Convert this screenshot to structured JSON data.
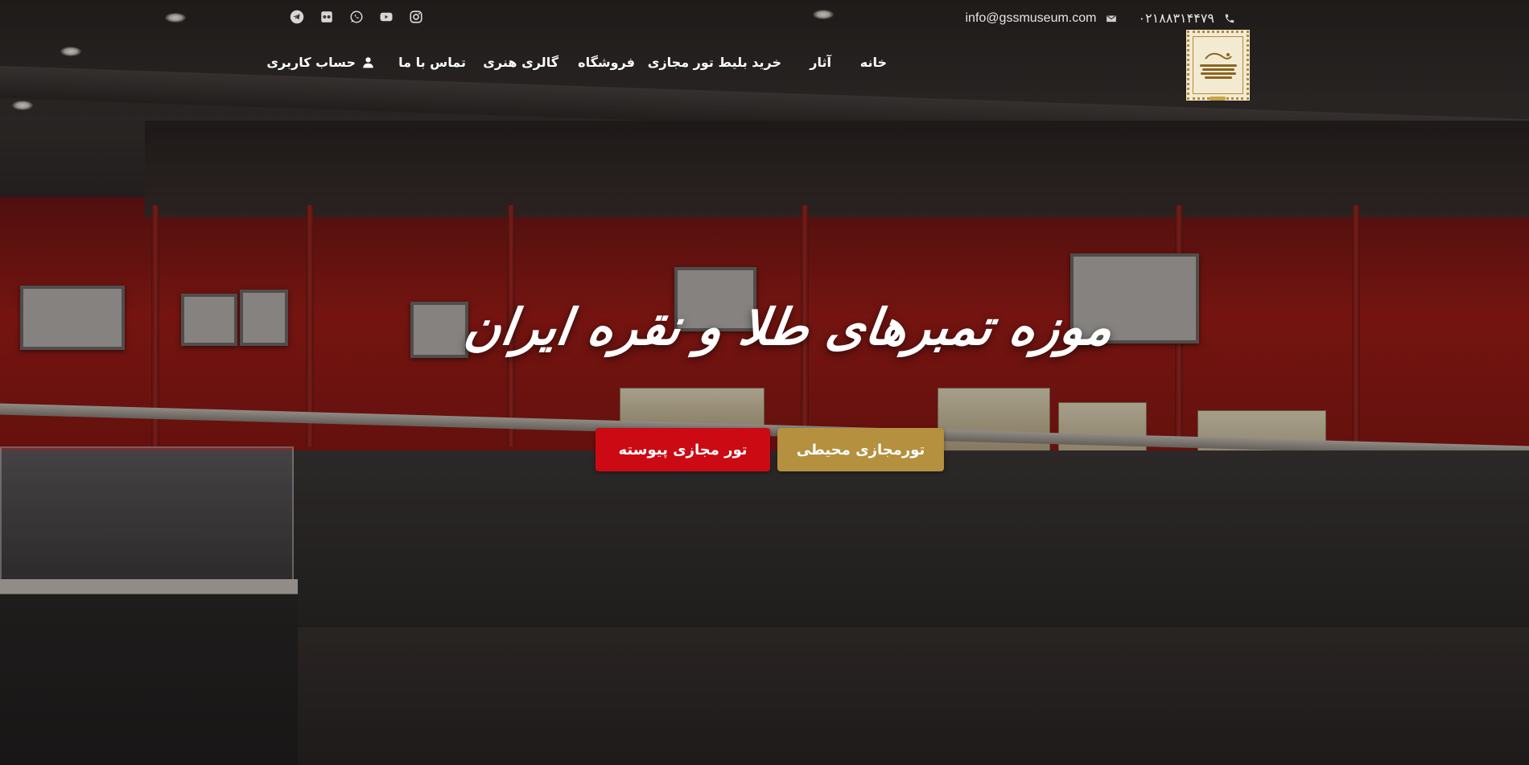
{
  "contact": {
    "phone": "۰۲۱۸۸۳۱۴۴۷۹",
    "email": "info@gssmuseum.com",
    "phone_icon": "phone-icon",
    "email_icon": "mail-icon"
  },
  "socials": [
    {
      "name": "instagram-icon"
    },
    {
      "name": "youtube-icon"
    },
    {
      "name": "whatsapp-icon"
    },
    {
      "name": "flickr-icon"
    },
    {
      "name": "telegram-icon"
    }
  ],
  "nav": {
    "home": "خانه",
    "works": "آثار",
    "tickets": "خرید بلیط تور مجازی",
    "shop": "فروشگاه",
    "gallery": "گالری هنری",
    "contact": "تماس با ما",
    "account": "حساب کاربری"
  },
  "hero": {
    "title": "موزه تمبرهای طلا و نقره ایران",
    "btn_ambient": "تورمجازی محیطی",
    "btn_continuous": "تور مجازی پیوسته"
  },
  "colors": {
    "gold": "#b4903f",
    "red": "#cc0a14"
  }
}
